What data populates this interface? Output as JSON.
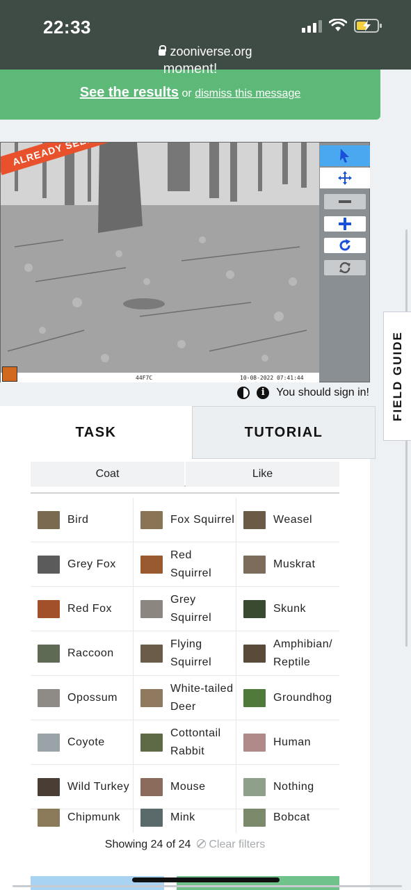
{
  "status": {
    "time": "22:33",
    "url": "zooniverse.org"
  },
  "notice": {
    "top_text": "moment!",
    "see_results": "See the results",
    "or": "or",
    "dismiss": "dismiss this message"
  },
  "viewer": {
    "ribbon": "ALREADY SEEN!",
    "camera_id": "44F7C",
    "timestamp": "10-08-2022 07:41:44",
    "sign_in": "You should sign in!"
  },
  "field_guide": "FIELD GUIDE",
  "tabs": {
    "task": "TASK",
    "tutorial": "TUTORIAL"
  },
  "filters": [
    "Coat",
    "Like"
  ],
  "species": [
    {
      "label": "Bird",
      "color": "#7a6a50"
    },
    {
      "label": "Fox Squirrel",
      "color": "#8a7456"
    },
    {
      "label": "Weasel",
      "color": "#6b5a45"
    },
    {
      "label": "Grey Fox",
      "color": "#5b5b5b"
    },
    {
      "label": "Red Squirrel",
      "color": "#9a5a30"
    },
    {
      "label": "Muskrat",
      "color": "#7d6b5b"
    },
    {
      "label": "Red Fox",
      "color": "#a2502a"
    },
    {
      "label": "Grey Squirrel",
      "color": "#8b8680"
    },
    {
      "label": "Skunk",
      "color": "#3a4a30"
    },
    {
      "label": "Raccoon",
      "color": "#5f6a55"
    },
    {
      "label": "Flying Squirrel",
      "color": "#6b5c4a"
    },
    {
      "label": "Amphibian/ Reptile",
      "color": "#5a4a3a"
    },
    {
      "label": "Opossum",
      "color": "#8e8a86"
    },
    {
      "label": "White-tailed Deer",
      "color": "#8f7a5f"
    },
    {
      "label": "Groundhog",
      "color": "#4f7a3a"
    },
    {
      "label": "Coyote",
      "color": "#9aa4a8"
    },
    {
      "label": "Cottontail Rabbit",
      "color": "#5e6a45"
    },
    {
      "label": "Human",
      "color": "#b08a88"
    },
    {
      "label": "Wild Turkey",
      "color": "#4a3e34"
    },
    {
      "label": "Mouse",
      "color": "#8a6a5a"
    },
    {
      "label": "Nothing",
      "color": "#8fa08a"
    },
    {
      "label": "Chipmunk",
      "color": "#8a7a5a"
    },
    {
      "label": "Mink",
      "color": "#5a6a6a"
    },
    {
      "label": "Bobcat",
      "color": "#7a8a6a"
    }
  ],
  "showing": "Showing 24 of 24",
  "clear_filters": "Clear filters"
}
